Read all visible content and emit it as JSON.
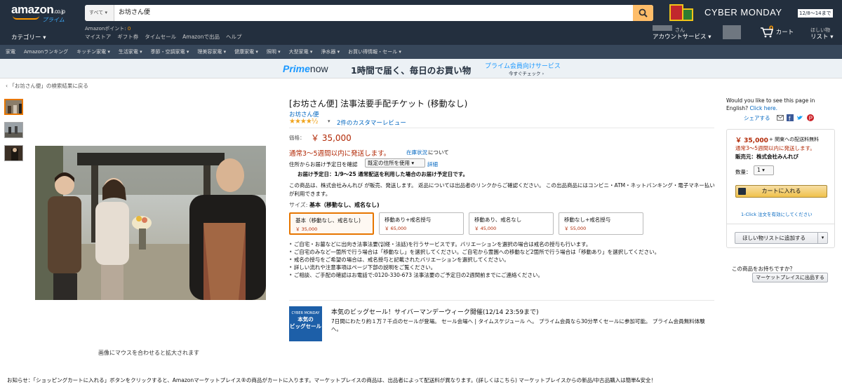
{
  "header": {
    "logo": "amazon",
    "logo_suffix": ".co.jp",
    "logo_prime": "プライム",
    "search_dept": "すべて",
    "search_value": "お坊さん便",
    "points_label": "Amazonポイント:",
    "points_value": "0",
    "category": "カテゴリー",
    "links": [
      "マイストア",
      "ギフト券",
      "タイムセール",
      "Amazonで出品",
      "ヘルプ"
    ],
    "cyber_monday": "CYBER MONDAY",
    "cyber_date": "12/8～14まで",
    "account_line1": "さん",
    "account_line2": "アカウントサービス",
    "cart_count": "0",
    "cart_label": "カート",
    "list_line1": "ほしい物",
    "list_line2": "リスト"
  },
  "subnav": [
    "家電",
    "Amazonランキング",
    "キッチン家電",
    "生活家電",
    "季節・空調家電",
    "理美容家電",
    "健康家電",
    "照明",
    "大型家電",
    "浄水器",
    "お買い得情報・セール"
  ],
  "primenow": {
    "logo_a": "Prime",
    "logo_b": "now",
    "text": "1時間で届く、毎日のお買い物",
    "sub": "プライム会員向けサービス",
    "check": "今すぐチェック"
  },
  "breadcrumb": "‹ 「お坊さん便」の検索結果に戻る",
  "product": {
    "title": "[お坊さん便] 法事法要手配チケット (移動なし)",
    "brand": "お坊さん便",
    "stars": "★★★★½",
    "rating": 4.5,
    "reviews": "2件のカスタマーレビュー",
    "price_label": "価格：",
    "price": "￥ 35,000",
    "ship_status": "通常3～5週間以内に発送します。",
    "ship_status_link": "在庫状況",
    "ship_status_tail": "について",
    "addr_label": "住所からお届け予定日を確認",
    "addr_select": "既定の住所を使用",
    "addr_detail": "詳細",
    "delivery": "お届け予定日：1/9～25 通常配送を利用した場合のお届け予定日です。",
    "seller_note": "この商品は、株式会社みんれび が販売、発送します。 返品については出品者のリンクからご確認ください。 この出品商品にはコンビニ・ATM・ネットバンキング・電子マネー払いが利用できます。",
    "size_label": "サイズ:",
    "size_value": "基本（移動なし、戒名なし)",
    "variants": [
      {
        "name": "基本（移動なし、戒名なし)",
        "price": "￥ 35,000"
      },
      {
        "name": "移動あり+戒名授与",
        "price": "￥ 65,000"
      },
      {
        "name": "移動あり、戒名なし",
        "price": "￥ 45,000"
      },
      {
        "name": "移動なし+戒名授与",
        "price": "￥ 55,000"
      }
    ],
    "bullets": [
      "ご自宅・お墓などに出向き法事法要(읽経・法話)を行うサービスです。バリエーションを選択の場合は戒名の授与も行います。",
      "ご自宅のみなど一箇所で行う場合は「移動なし」を選択してください。ご自宅から霊園への移動など2箇所で行う場合は「移動あり」を選択してください。",
      "戒名の授与をご希望の場合は、戒名授与と記載されたバリエーションを選択してください。",
      "詳しい流れや注意事項はページ下部の説明をご覧ください。",
      "ご相談、ご手配の確認はお電話で:0120-330-673 法事法要のご予定日の2週間前までにご連絡ください。"
    ],
    "hover_hint": "画像にマウスを合わせると拡大されます"
  },
  "cyber": {
    "logo_top": "CYBER MONDAY",
    "logo_bot": "本気の\nビッグセール",
    "title": "本気のビッグセール！サイバーマンデーウィーク開催(12/14 23:59まで)",
    "body": "7日間にわたり約１万７千点のセールが登場。 セール会場へ | タイムスケジュール へ。 プライム会員なら30分早くセールに参加可能。 プライム会員無料体験 へ。"
  },
  "right": {
    "translate_q": "Would you like to see this page in English?",
    "translate_link": "Click here.",
    "share": "シェアする",
    "price": "￥ 35,000",
    "ship": "+ 関東への配送料無料",
    "stock": "通常3～5週間以内に発送します。",
    "seller": "販売元：株式会社みんれび",
    "qty_label": "数量：",
    "qty": "1",
    "add_to_cart": "カートに入れる",
    "oneclick": "1-Click 注文を有効にしてください",
    "wishlist": "ほしい物リストに追加する",
    "sell_q": "この商品をお持ちですか？",
    "sell_btn": "マーケットプレイスに出品する"
  },
  "notice": "お知らせ：「ショッピングカートに入れる」ボタンをクリックすると、Amazonマーケットプレイス®の商品がカートに入ります。マーケットプレイスの商品は、出品者によって配送料が異なります。(詳しくはこちら) マーケットプレイスからの新品/中古品購入は簡単&安全！",
  "colors": {
    "nav_bg": "#232f3e",
    "subnav_bg": "#37475a",
    "accent": "#f90",
    "price": "#b12704",
    "link": "#0066c0",
    "cart_button": "#f0c14b"
  }
}
